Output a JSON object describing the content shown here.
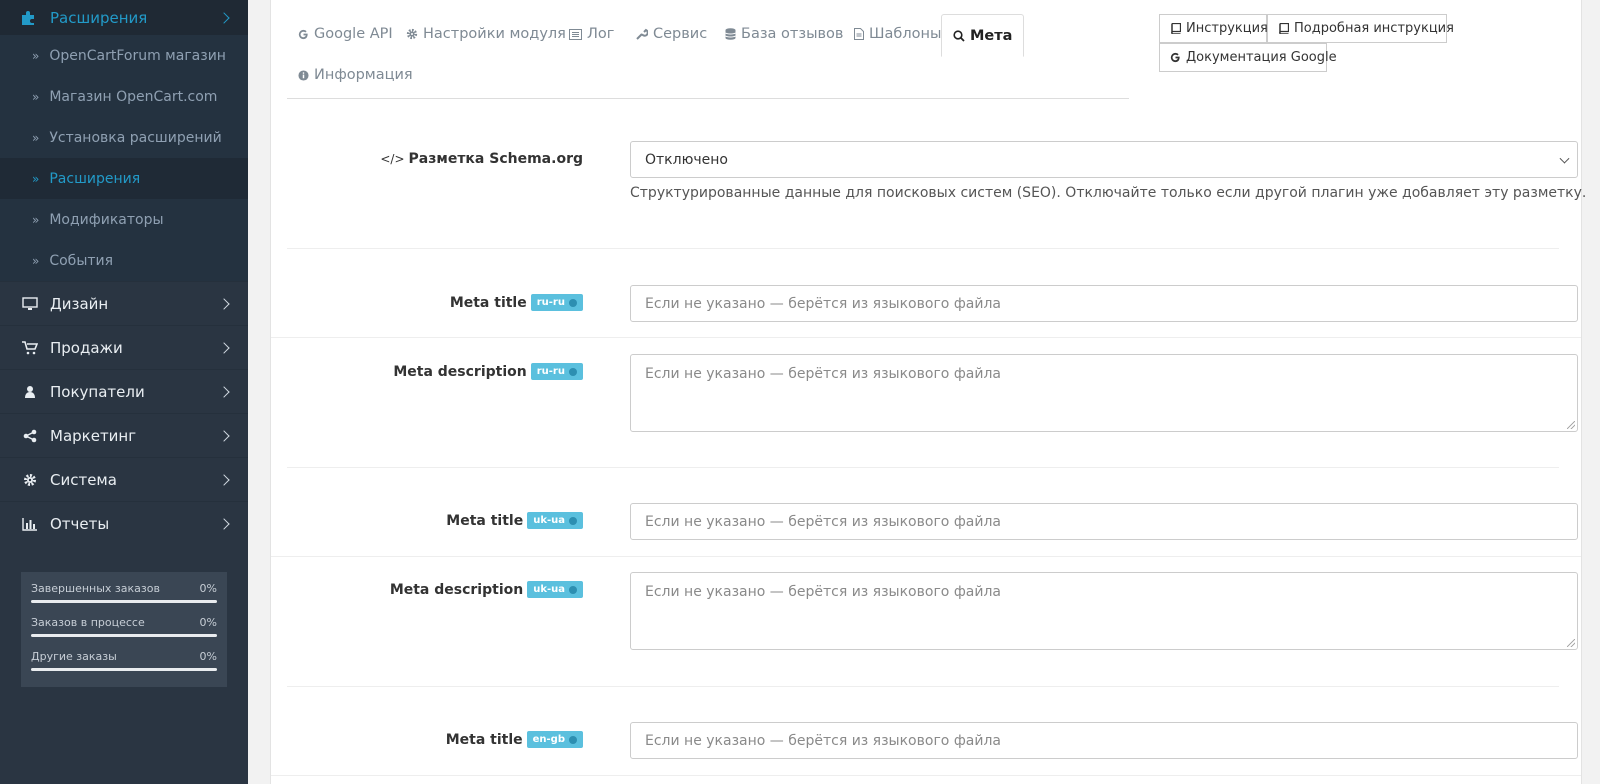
{
  "sidebar": {
    "top_item": "Расширения",
    "submenu": [
      {
        "label": "OpenCartForum магазин",
        "active": false
      },
      {
        "label": "Магазин OpenCart.com",
        "active": false
      },
      {
        "label": "Установка расширений",
        "active": false
      },
      {
        "label": "Расширения",
        "active": true
      },
      {
        "label": "Модификаторы",
        "active": false
      },
      {
        "label": "События",
        "active": false
      }
    ],
    "main_items": [
      {
        "label": "Дизайн",
        "icon": "desktop-icon"
      },
      {
        "label": "Продажи",
        "icon": "cart-icon"
      },
      {
        "label": "Покупатели",
        "icon": "user-icon"
      },
      {
        "label": "Маркетинг",
        "icon": "share-icon"
      },
      {
        "label": "Система",
        "icon": "gear-icon"
      },
      {
        "label": "Отчеты",
        "icon": "bar-chart-icon"
      }
    ],
    "stats": [
      {
        "label": "Завершенных заказов",
        "value": "0%",
        "progress": 0
      },
      {
        "label": "Заказов в процессе",
        "value": "0%",
        "progress": 0
      },
      {
        "label": "Другие заказы",
        "value": "0%",
        "progress": 0
      }
    ]
  },
  "tabs": [
    {
      "label": "Google API",
      "icon": "google-icon",
      "active": false
    },
    {
      "label": "Настройки модуля",
      "icon": "gear-icon",
      "active": false
    },
    {
      "label": "Лог",
      "icon": "list-icon",
      "active": false
    },
    {
      "label": "Сервис",
      "icon": "wrench-icon",
      "active": false
    },
    {
      "label": "База отзывов",
      "icon": "database-icon",
      "active": false
    },
    {
      "label": "Шаблоны",
      "icon": "file-icon",
      "active": false
    },
    {
      "label": "Мета",
      "icon": "search-icon",
      "active": true
    },
    {
      "label": "Информация",
      "icon": "info-icon",
      "active": false
    }
  ],
  "help_buttons": [
    {
      "label": "Инструкция",
      "icon": "book-icon"
    },
    {
      "label": "Подробная инструкция",
      "icon": "book-icon"
    },
    {
      "label": "Документация Google",
      "icon": "google-icon"
    }
  ],
  "schema": {
    "label": "Разметка Schema.org",
    "value": "Отключено",
    "help": "Структурированные данные для поисковых систем (SEO). Отключайте только если другой плагин уже добавляет эту разметку."
  },
  "meta_fields": [
    {
      "title_label": "Meta title",
      "desc_label": "Meta description",
      "lang": "ru-ru",
      "placeholder": "Если не указано — берётся из языкового файла"
    },
    {
      "title_label": "Meta title",
      "desc_label": "Meta description",
      "lang": "uk-ua",
      "placeholder": "Если не указано — берётся из языкового файла"
    },
    {
      "title_label": "Meta title",
      "lang": "en-gb",
      "placeholder": "Если не указано — берётся из языкового файла"
    }
  ],
  "colors": {
    "accent": "#229ac8",
    "sidebar_bg": "#2a3542",
    "badge": "#5bc0de"
  }
}
